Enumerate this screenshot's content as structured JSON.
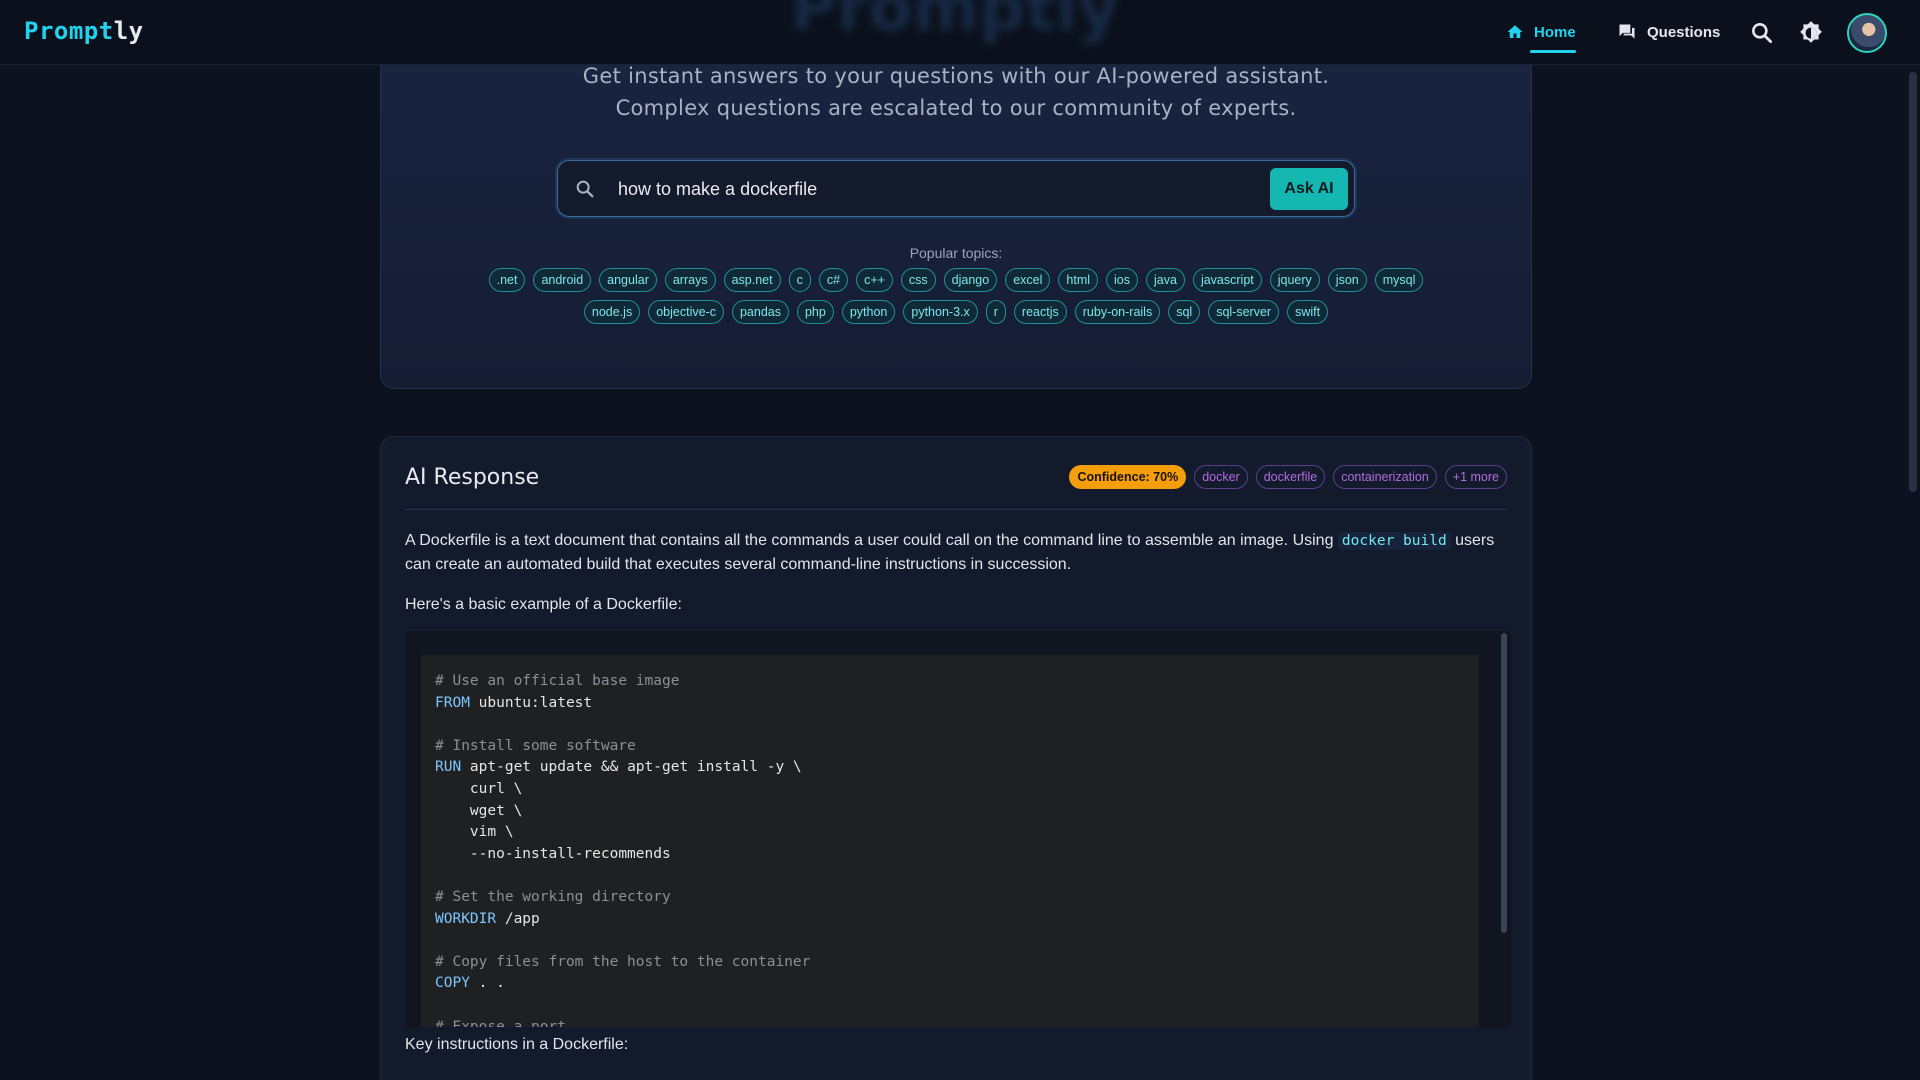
{
  "nav": {
    "logo_part1": "Prompt",
    "logo_part2": "ly",
    "home_label": "Home",
    "questions_label": "Questions",
    "accent": "#22d3ee"
  },
  "hero": {
    "ghost_title": "Promptly",
    "subtitle_line1": "Get instant answers to your questions with our AI-powered assistant.",
    "subtitle_line2": "Complex questions are escalated to our community of experts."
  },
  "search": {
    "value": "how to make a dockerfile",
    "button_label": "Ask AI",
    "popular_label": "Popular topics:",
    "topics_row1": [
      ".net",
      "android",
      "angular",
      "arrays",
      "asp.net",
      "c",
      "c#",
      "c++",
      "css",
      "django",
      "excel",
      "html",
      "ios",
      "java",
      "javascript",
      "jquery",
      "json",
      "mysql"
    ],
    "topics_row2": [
      "node.js",
      "objective-c",
      "pandas",
      "php",
      "python",
      "python-3.x",
      "r",
      "reactjs",
      "ruby-on-rails",
      "sql",
      "sql-server",
      "swift"
    ]
  },
  "ai": {
    "title": "AI Response",
    "confidence": "Confidence: 70%",
    "topics": [
      "docker",
      "dockerfile",
      "containerization",
      "+1 more"
    ],
    "intro_part1": "A Dockerfile is a text document that contains all the commands a user could call on the command line to assemble an image. Using ",
    "intro_code": "docker build",
    "intro_part2": " users can create an automated build that executes several command-line instructions in succession.",
    "example_heading": "Here's a basic example of a Dockerfile:",
    "code_lines": [
      {
        "type": "comment",
        "text": "# Use an official base image"
      },
      {
        "type": "code",
        "kw": "FROM",
        "text": " ubuntu:latest"
      },
      {
        "type": "blank",
        "text": ""
      },
      {
        "type": "comment",
        "text": "# Install some software"
      },
      {
        "type": "code",
        "kw": "RUN",
        "text": " apt-get update && apt-get install -y \\"
      },
      {
        "type": "code",
        "kw": "",
        "text": "    curl \\"
      },
      {
        "type": "code",
        "kw": "",
        "text": "    wget \\"
      },
      {
        "type": "code",
        "kw": "",
        "text": "    vim \\"
      },
      {
        "type": "code",
        "kw": "",
        "text": "    --no-install-recommends"
      },
      {
        "type": "blank",
        "text": ""
      },
      {
        "type": "comment",
        "text": "# Set the working directory"
      },
      {
        "type": "code",
        "kw": "WORKDIR",
        "text": " /app"
      },
      {
        "type": "blank",
        "text": ""
      },
      {
        "type": "comment",
        "text": "# Copy files from the host to the container"
      },
      {
        "type": "code",
        "kw": "COPY",
        "text": " . ."
      },
      {
        "type": "blank",
        "text": ""
      },
      {
        "type": "comment",
        "text": "# Expose a port"
      }
    ],
    "key_heading": "Key instructions in a Dockerfile:"
  }
}
